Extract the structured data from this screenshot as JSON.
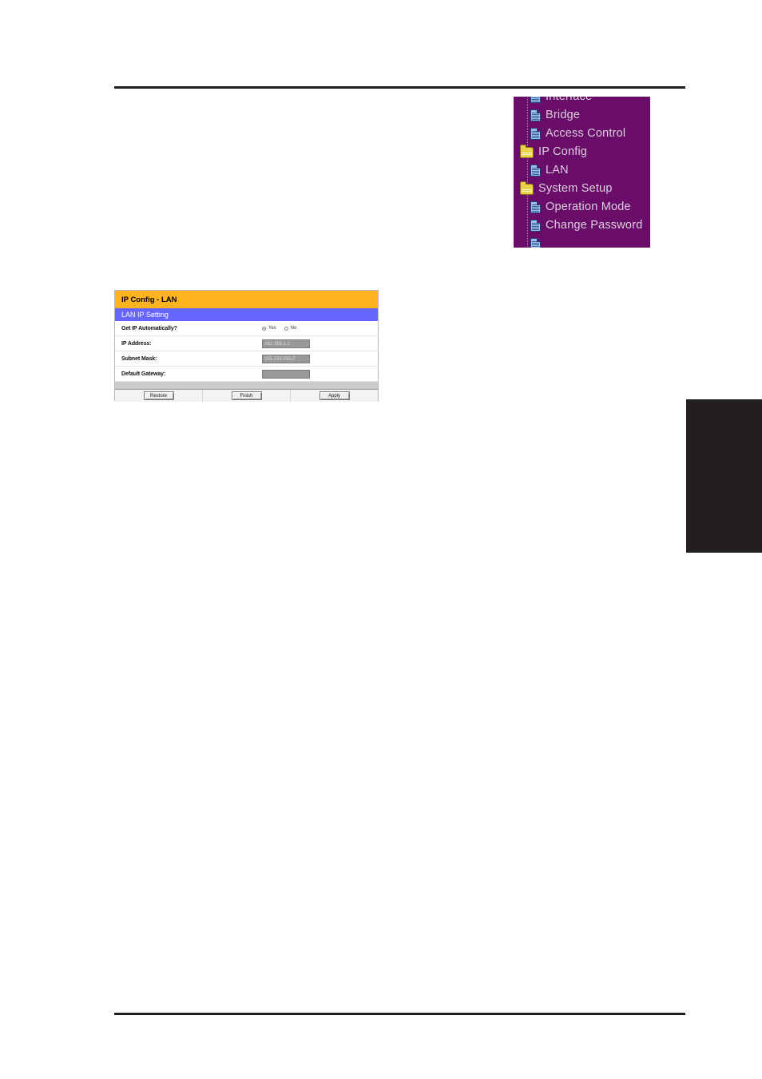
{
  "page": {
    "rule_color": "#231f20",
    "edge_tab_color": "#231f20"
  },
  "sidebar": {
    "background": "#6a0d6a",
    "text_color": "#dcd0dc",
    "items": [
      {
        "label": "Interface",
        "icon": "document-icon",
        "level": 2,
        "clipped": "top"
      },
      {
        "label": "Bridge",
        "icon": "document-icon",
        "level": 2
      },
      {
        "label": "Access Control",
        "icon": "document-icon",
        "level": 2
      },
      {
        "label": "IP Config",
        "icon": "folder-icon",
        "level": 1
      },
      {
        "label": "LAN",
        "icon": "document-icon",
        "level": 2
      },
      {
        "label": "System Setup",
        "icon": "folder-icon",
        "level": 1
      },
      {
        "label": "Operation Mode",
        "icon": "document-icon",
        "level": 2
      },
      {
        "label": "Change Password",
        "icon": "document-icon",
        "level": 2
      },
      {
        "label": "",
        "icon": "document-icon",
        "level": 2,
        "clipped": "bottom"
      }
    ]
  },
  "form": {
    "title": "IP Config - LAN",
    "title_bg": "#ffb31f",
    "subtitle": "LAN IP Setting",
    "subtitle_bg": "#6666ff",
    "rows": [
      {
        "label": "Get IP Automatically?",
        "type": "radio",
        "options": [
          "Yes",
          "No"
        ],
        "selected": "Yes"
      },
      {
        "label": "IP Address:",
        "type": "text",
        "value": "192.168.1.1"
      },
      {
        "label": "Subnet Mask:",
        "type": "text",
        "value": "255.255.255.0"
      },
      {
        "label": "Default Gateway:",
        "type": "text",
        "value": ""
      }
    ],
    "buttons": [
      {
        "label": "Restore"
      },
      {
        "label": "Finish"
      },
      {
        "label": "Apply"
      }
    ]
  }
}
